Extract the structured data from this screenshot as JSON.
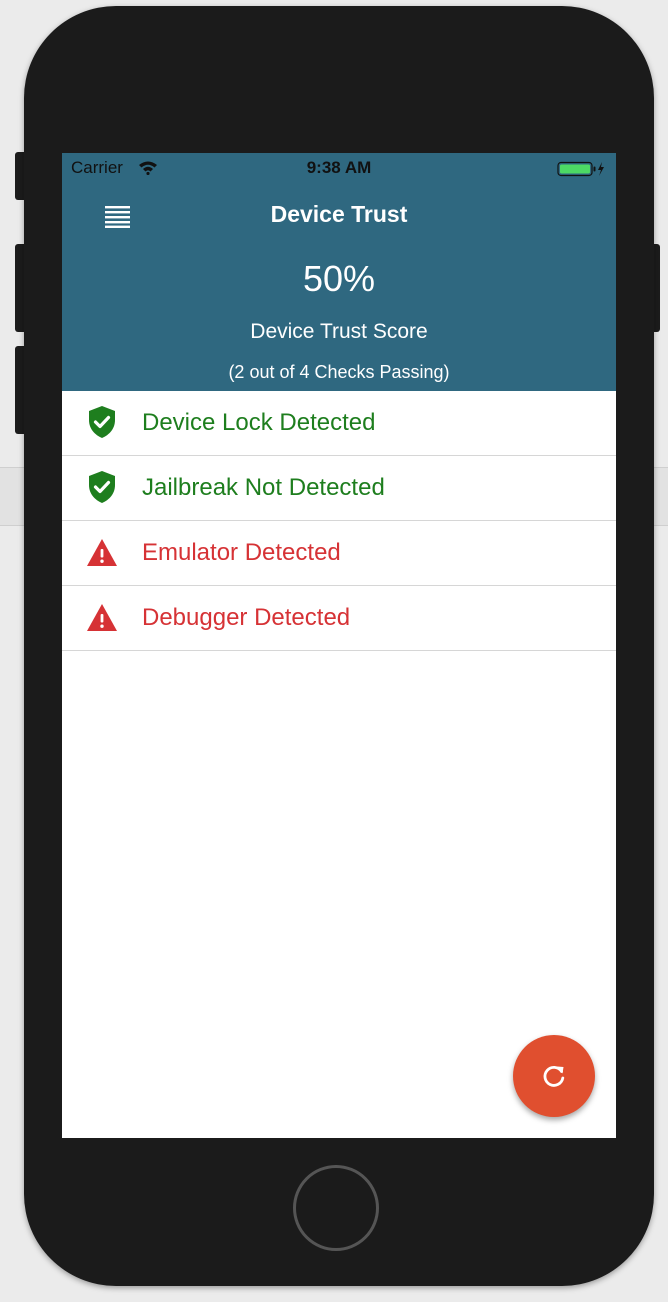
{
  "status_bar": {
    "carrier": "Carrier",
    "time": "9:38 AM",
    "wifi_icon": "wifi-icon",
    "battery_icon": "battery-charging-icon"
  },
  "header": {
    "menu_icon": "hamburger-menu-icon",
    "title": "Device Trust",
    "background_color": "#2f6880"
  },
  "trust": {
    "score": "50%",
    "label": "Device Trust Score",
    "summary": "(2 out of 4 Checks Passing)"
  },
  "checks": [
    {
      "label": "Device Lock Detected",
      "status": "pass",
      "icon": "shield-check-icon"
    },
    {
      "label": "Jailbreak Not Detected",
      "status": "pass",
      "icon": "shield-check-icon"
    },
    {
      "label": "Emulator Detected",
      "status": "fail",
      "icon": "warning-triangle-icon"
    },
    {
      "label": "Debugger Detected",
      "status": "fail",
      "icon": "warning-triangle-icon"
    }
  ],
  "colors": {
    "pass": "#1e7e1e",
    "fail": "#d63235",
    "fab": "#e04f2f"
  },
  "fab": {
    "icon": "refresh-icon"
  }
}
